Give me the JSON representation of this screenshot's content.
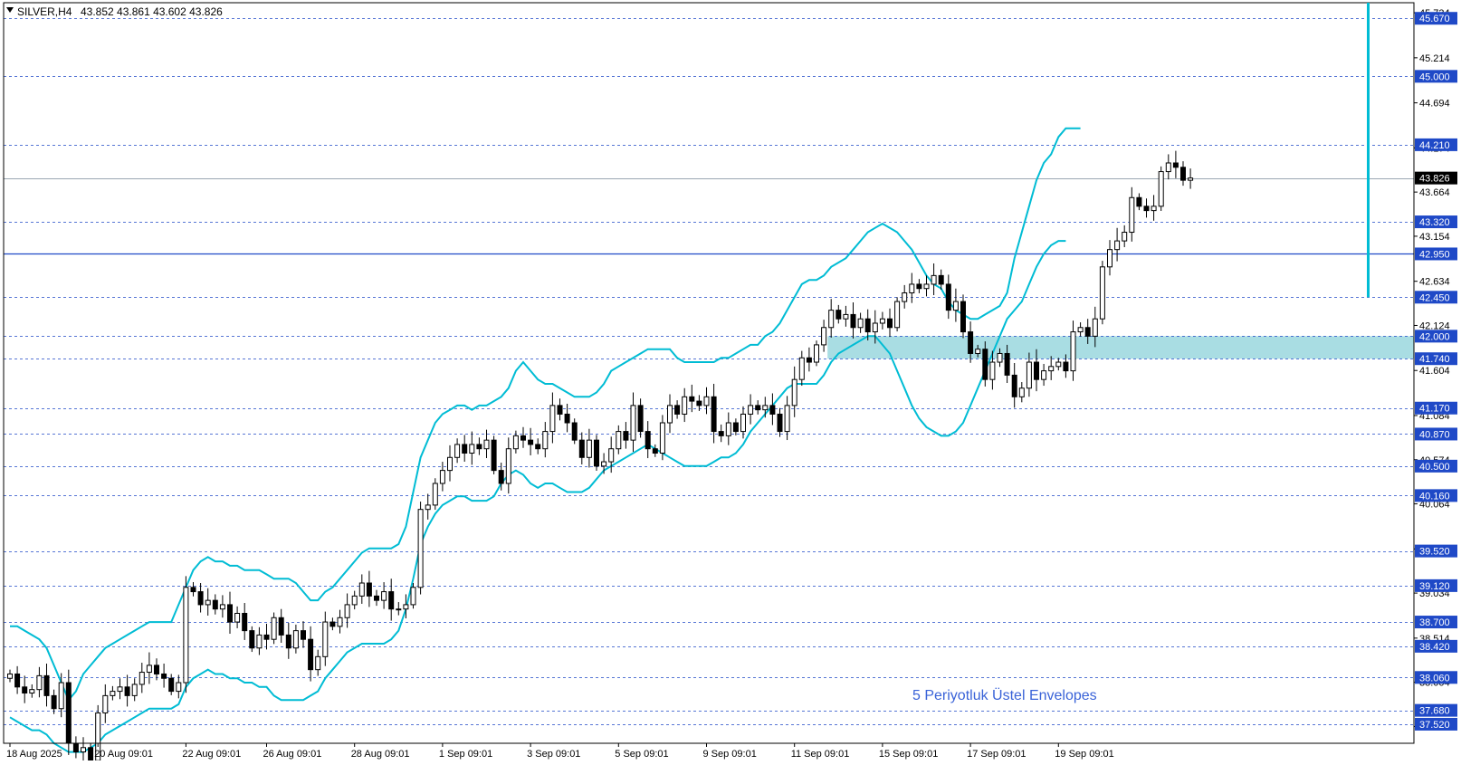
{
  "header": {
    "symbol": "SILVER,H4",
    "ohlc": "43.852 43.861 43.602 43.826"
  },
  "annotation": "5 Periyotluk Üstel Envelopes",
  "colors": {
    "envelope": "#00bcd4",
    "level_line": "#1f49c7",
    "current_line": "#9aa6b2",
    "zone": "#a9dde3",
    "candle": "#000000",
    "bullish_fill": "#ffffff",
    "bearish_fill": "#000000",
    "level_tag": "#1f49c7",
    "current_tag": "#000000",
    "right_edge": "#00bcd4"
  },
  "chart_data": {
    "type": "candlestick",
    "timeframe": "H4",
    "ylim": [
      37.3,
      45.85
    ],
    "y_ticks": [
      "45.734",
      "45.214",
      "44.694",
      "44.174",
      "43.664",
      "43.154",
      "42.634",
      "42.124",
      "41.604",
      "41.084",
      "40.574",
      "40.064",
      "39.544",
      "39.034",
      "38.514",
      "38.004",
      "37.494"
    ],
    "x_ticks": [
      "18 Aug 2025",
      "20 Aug 09:01",
      "22 Aug 09:01",
      "26 Aug 09:01",
      "28 Aug 09:01",
      "1 Sep 09:01",
      "3 Sep 09:01",
      "5 Sep 09:01",
      "9 Sep 09:01",
      "11 Sep 09:01",
      "15 Sep 09:01",
      "17 Sep 09:01",
      "19 Sep 09:01"
    ],
    "x_tick_index": [
      0,
      12,
      24,
      35,
      47,
      59,
      71,
      83,
      95,
      107,
      119,
      131,
      143
    ],
    "levels": [
      "45.670",
      "45.000",
      "44.210",
      "43.320",
      "42.950",
      "42.450",
      "42.000",
      "41.740",
      "41.170",
      "40.870",
      "40.500",
      "40.160",
      "39.520",
      "39.120",
      "38.700",
      "38.420",
      "38.060",
      "37.680",
      "37.520"
    ],
    "key_level": "42.950",
    "current_price": "43.826",
    "zone": {
      "low": 41.74,
      "high": 42.0,
      "start_index": 112
    },
    "closes": [
      38.1,
      37.95,
      37.88,
      37.92,
      38.08,
      37.85,
      37.7,
      38.0,
      37.3,
      37.2,
      37.25,
      37.1,
      37.65,
      37.85,
      37.9,
      37.95,
      37.85,
      37.98,
      38.12,
      38.2,
      38.1,
      38.05,
      37.9,
      38.0,
      39.1,
      39.05,
      38.9,
      38.95,
      38.85,
      38.9,
      38.7,
      38.8,
      38.6,
      38.4,
      38.55,
      38.5,
      38.75,
      38.55,
      38.4,
      38.6,
      38.5,
      38.15,
      38.3,
      38.7,
      38.65,
      38.75,
      38.9,
      39.0,
      39.15,
      39.0,
      38.95,
      39.05,
      38.85,
      38.85,
      38.9,
      39.1,
      40.0,
      40.05,
      40.3,
      40.45,
      40.6,
      40.75,
      40.65,
      40.75,
      40.7,
      40.8,
      40.45,
      40.3,
      40.7,
      40.85,
      40.8,
      40.75,
      40.7,
      40.9,
      41.2,
      41.1,
      41.0,
      40.8,
      40.6,
      40.8,
      40.5,
      40.55,
      40.7,
      40.9,
      40.8,
      41.2,
      40.9,
      40.7,
      40.65,
      41.0,
      41.2,
      41.1,
      41.3,
      41.25,
      41.2,
      41.3,
      40.9,
      40.85,
      41.0,
      40.9,
      41.1,
      41.2,
      41.15,
      41.2,
      41.1,
      40.9,
      41.2,
      41.5,
      41.75,
      41.7,
      41.9,
      42.1,
      42.3,
      42.2,
      42.25,
      42.1,
      42.2,
      42.05,
      42.15,
      42.2,
      42.1,
      42.4,
      42.5,
      42.6,
      42.55,
      42.6,
      42.7,
      42.6,
      42.3,
      42.4,
      42.05,
      41.8,
      41.85,
      41.5,
      41.7,
      41.8,
      41.55,
      41.3,
      41.4,
      41.7,
      41.5,
      41.6,
      41.65,
      41.7,
      41.6,
      42.05,
      42.1,
      42.0,
      42.2,
      42.8,
      43.0,
      43.1,
      43.2,
      43.6,
      43.5,
      43.45,
      43.5,
      43.9,
      44.0,
      43.95,
      43.8,
      43.826
    ],
    "upper_envelope": [
      38.65,
      38.65,
      38.6,
      38.55,
      38.5,
      38.4,
      38.2,
      38.0,
      37.8,
      37.9,
      38.1,
      38.2,
      38.3,
      38.4,
      38.45,
      38.5,
      38.55,
      38.6,
      38.65,
      38.7,
      38.7,
      38.7,
      38.7,
      38.9,
      39.1,
      39.3,
      39.4,
      39.45,
      39.4,
      39.4,
      39.35,
      39.35,
      39.3,
      39.3,
      39.3,
      39.25,
      39.2,
      39.2,
      39.2,
      39.15,
      39.05,
      38.95,
      38.95,
      39.05,
      39.1,
      39.2,
      39.3,
      39.4,
      39.5,
      39.55,
      39.55,
      39.55,
      39.55,
      39.6,
      39.8,
      40.2,
      40.6,
      40.8,
      41.0,
      41.1,
      41.15,
      41.2,
      41.2,
      41.15,
      41.2,
      41.2,
      41.25,
      41.3,
      41.4,
      41.6,
      41.7,
      41.6,
      41.5,
      41.45,
      41.45,
      41.4,
      41.35,
      41.3,
      41.3,
      41.3,
      41.35,
      41.45,
      41.6,
      41.65,
      41.7,
      41.75,
      41.8,
      41.85,
      41.85,
      41.85,
      41.85,
      41.75,
      41.7,
      41.7,
      41.7,
      41.7,
      41.7,
      41.75,
      41.75,
      41.8,
      41.85,
      41.9,
      41.9,
      42.0,
      42.05,
      42.15,
      42.3,
      42.45,
      42.6,
      42.65,
      42.65,
      42.7,
      42.8,
      42.85,
      42.9,
      43.0,
      43.1,
      43.2,
      43.25,
      43.3,
      43.25,
      43.2,
      43.1,
      43.0,
      42.85,
      42.7,
      42.6,
      42.55,
      42.4,
      42.3,
      42.25,
      42.2,
      42.2,
      42.25,
      42.3,
      42.35,
      42.5,
      42.9,
      43.2,
      43.5,
      43.8,
      44.0,
      44.1,
      44.3,
      44.4,
      44.4,
      44.4
    ],
    "lower_envelope": [
      37.6,
      37.55,
      37.5,
      37.45,
      37.45,
      37.4,
      37.3,
      37.25,
      37.2,
      37.2,
      37.2,
      37.25,
      37.3,
      37.4,
      37.45,
      37.5,
      37.55,
      37.6,
      37.65,
      37.7,
      37.7,
      37.7,
      37.7,
      37.75,
      37.95,
      38.05,
      38.1,
      38.15,
      38.1,
      38.1,
      38.05,
      38.05,
      38.0,
      38.0,
      37.95,
      37.95,
      37.85,
      37.8,
      37.8,
      37.8,
      37.8,
      37.85,
      37.9,
      38.05,
      38.15,
      38.25,
      38.35,
      38.4,
      38.45,
      38.45,
      38.45,
      38.45,
      38.5,
      38.6,
      38.85,
      39.2,
      39.6,
      39.8,
      39.95,
      40.05,
      40.1,
      40.15,
      40.15,
      40.1,
      40.1,
      40.1,
      40.15,
      40.3,
      40.4,
      40.45,
      40.4,
      40.3,
      40.25,
      40.3,
      40.3,
      40.25,
      40.2,
      40.2,
      40.2,
      40.25,
      40.35,
      40.45,
      40.5,
      40.55,
      40.6,
      40.65,
      40.7,
      40.75,
      40.7,
      40.65,
      40.6,
      40.55,
      40.5,
      40.5,
      40.5,
      40.5,
      40.55,
      40.6,
      40.6,
      40.65,
      40.75,
      40.9,
      41.0,
      41.1,
      41.2,
      41.3,
      41.4,
      41.45,
      41.45,
      41.45,
      41.45,
      41.55,
      41.7,
      41.8,
      41.85,
      41.9,
      41.95,
      42.0,
      42.0,
      41.9,
      41.8,
      41.6,
      41.4,
      41.2,
      41.05,
      40.95,
      40.9,
      40.85,
      40.85,
      40.9,
      41.0,
      41.2,
      41.4,
      41.6,
      41.8,
      42.0,
      42.2,
      42.3,
      42.4,
      42.6,
      42.8,
      42.95,
      43.05,
      43.1,
      43.1
    ]
  }
}
